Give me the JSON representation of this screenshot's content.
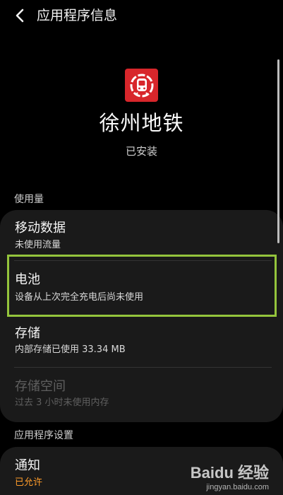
{
  "header": {
    "title": "应用程序信息",
    "back_icon": "chevron-left-icon"
  },
  "app": {
    "name": "徐州地铁",
    "status": "已安装",
    "icon": "metro-train-icon",
    "icon_color": "#d8262b"
  },
  "usage_section": {
    "label": "使用量",
    "items": [
      {
        "title": "移动数据",
        "subtitle": "未使用流量"
      },
      {
        "title": "电池",
        "subtitle": "设备从上次完全充电后尚未使用"
      },
      {
        "title": "存储",
        "subtitle": "内部存储已使用 33.34 MB"
      },
      {
        "title": "存储空间",
        "subtitle": "过去 3 小时未使用内存"
      }
    ]
  },
  "settings_section": {
    "label": "应用程序设置",
    "items": [
      {
        "title": "通知",
        "subtitle": "已允许"
      }
    ]
  },
  "colors": {
    "highlight": "#94c43c",
    "allowed_text": "#ff9c2a"
  },
  "watermark": {
    "line1": "Baidu 经验",
    "line2": "jingyan.baidu.com"
  }
}
